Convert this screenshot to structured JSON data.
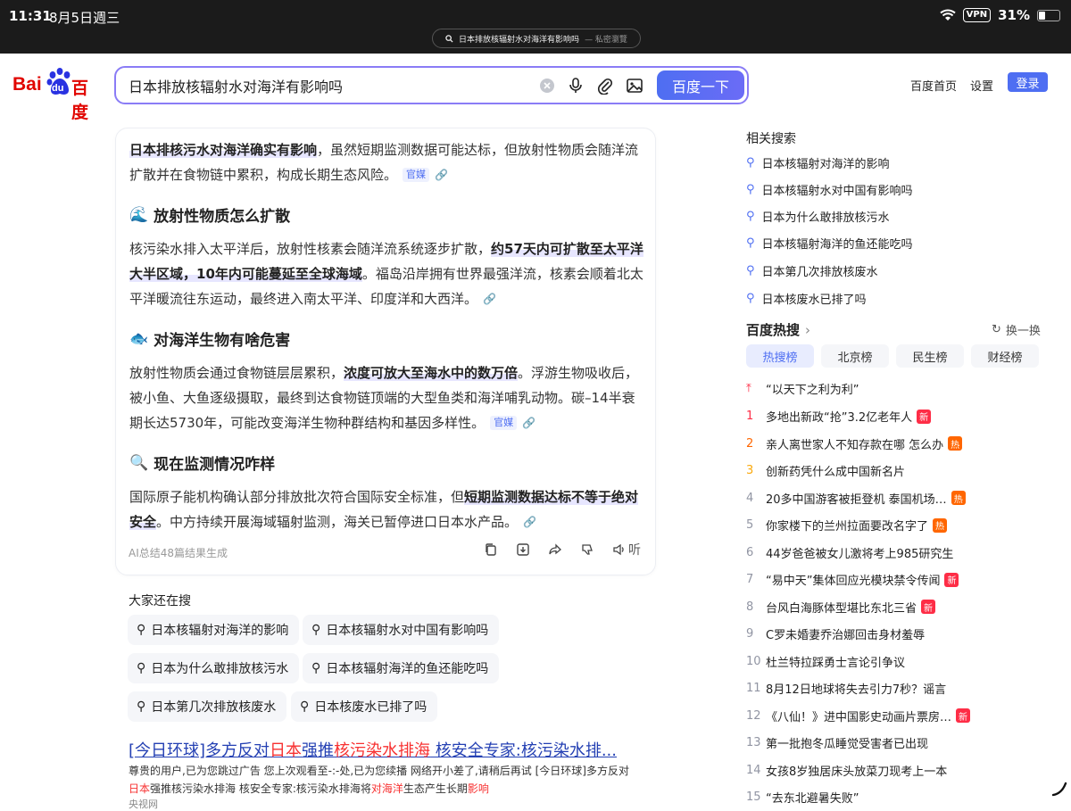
{
  "status_bar": {
    "time": "11:31",
    "date": "8月5日週三",
    "vpn": "VPN",
    "battery": "31%",
    "battery_level": 0.31
  },
  "url_bar": {
    "query": "日本排放核辐射水对海洋有影响吗",
    "mode": "— 私密瀏覽"
  },
  "header": {
    "logo_text_left": "Bai",
    "logo_text_paw": "du",
    "logo_text_right": "百度",
    "search_value": "日本排放核辐射水对海洋有影响吗",
    "search_button": "百度一下",
    "links": [
      "百度首页",
      "设置"
    ],
    "login": "登录"
  },
  "ai_card": {
    "intro_hl": "日本排核污水对海洋确实有影响",
    "intro_text": "，虽然短期监测数据可能达标，但放射性物质会随洋流扩散并在食物链中累积，构成长期生态风险。",
    "intro_tag": "官媒",
    "s1_emoji": "🌊",
    "s1_title": "放射性物质怎么扩散",
    "s1_a": "核污染水排入太平洋后，放射性核素会随洋流系统逐步扩散，",
    "s1_hl": "约57天内可扩散至太平洋大半区域，10年内可能蔓延至全球海域",
    "s1_b": "。福岛沿岸拥有世界最强洋流，核素会顺着北太平洋暖流往东运动，最终进入南太平洋、印度洋和大西洋。",
    "s2_emoji": "🐟",
    "s2_title": "对海洋生物有啥危害",
    "s2_a": "放射性物质会通过食物链层层累积，",
    "s2_hl": "浓度可放大至海水中的数万倍",
    "s2_b": "。浮游生物吸收后，被小鱼、大鱼逐级摄取，最终到达食物链顶端的大型鱼类和海洋哺乳动物。碳–14半衰期长达5730年，可能改变海洋生物种群结构和基因多样性。",
    "s2_tag": "官媒",
    "s3_emoji": "🔍",
    "s3_title": "现在监测情况咋样",
    "s3_a": "国际原子能机构确认部分排放批次符合国际安全标准，但",
    "s3_hl": "短期监测数据达标不等于绝对安全",
    "s3_b": "。中方持续开展海域辐射监测，海关已暂停进口日本水产品。",
    "footer": "AI总结48篇结果生成",
    "listen": "听"
  },
  "everyone_searches": {
    "title": "大家还在搜",
    "chips": [
      "日本核辐射对海洋的影响",
      "日本核辐射水对中国有影响吗",
      "日本为什么敢排放核污水",
      "日本核辐射海洋的鱼还能吃吗",
      "日本第几次排放核废水",
      "日本核废水已排了吗"
    ]
  },
  "result": {
    "title_parts": [
      "[今日环球]多方反对",
      "日本",
      "强推",
      "核污染水",
      "排海",
      " 核安全专家:核污染水排..."
    ],
    "snippet_line1": "尊贵的用户,已为您跳过广告 您上次观看至-:-处,已为您续播 网络开小差了,请稍后再试 [今日环球]多方反对",
    "snippet_line2_parts": [
      "日本",
      "强推核污染水排海 核安全专家:核污染水排海将",
      "对海洋",
      "生态产生长期",
      "影响"
    ],
    "source": "央视网"
  },
  "related": {
    "title": "相关搜索",
    "items": [
      "日本核辐射对海洋的影响",
      "日本核辐射水对中国有影响吗",
      "日本为什么敢排放核污水",
      "日本核辐射海洋的鱼还能吃吗",
      "日本第几次排放核废水",
      "日本核废水已排了吗"
    ]
  },
  "hot": {
    "title": "百度热搜",
    "refresh": "换一换",
    "tabs": [
      "热搜榜",
      "北京榜",
      "民生榜",
      "财经榜"
    ],
    "pinned": "“以天下之利为利”",
    "rows": [
      {
        "rank": "1",
        "text": "多地出新政“抢”3.2亿老年人",
        "badge": "新"
      },
      {
        "rank": "2",
        "text": "亲人离世家人不知存款在哪 怎么办",
        "badge": "热"
      },
      {
        "rank": "3",
        "text": "创新药凭什么成中国新名片",
        "badge": ""
      },
      {
        "rank": "4",
        "text": "20多中国游客被拒登机 泰国机场…",
        "badge": "热"
      },
      {
        "rank": "5",
        "text": "你家楼下的兰州拉面要改名字了",
        "badge": "热"
      },
      {
        "rank": "6",
        "text": "44岁爸爸被女儿激将考上985研究生",
        "badge": ""
      },
      {
        "rank": "7",
        "text": "“易中天”集体回应光模块禁令传闻",
        "badge": "新"
      },
      {
        "rank": "8",
        "text": "台风白海豚体型堪比东北三省",
        "badge": "新"
      },
      {
        "rank": "9",
        "text": "C罗未婚妻乔治娜回击身材羞辱",
        "badge": ""
      },
      {
        "rank": "10",
        "text": "杜兰特拉踩勇士言论引争议",
        "badge": ""
      },
      {
        "rank": "11",
        "text": "8月12日地球将失去引力7秒？谣言",
        "badge": ""
      },
      {
        "rank": "12",
        "text": "《八仙！》进中国影史动画片票房…",
        "badge": "新"
      },
      {
        "rank": "13",
        "text": "第一批抱冬瓜睡觉受害者已出现",
        "badge": ""
      },
      {
        "rank": "14",
        "text": "女孩8岁独居床头放菜刀现考上一本",
        "badge": ""
      },
      {
        "rank": "15",
        "text": "“去东北避暑失败”",
        "badge": ""
      }
    ]
  },
  "colors": {
    "accent": "#4e6ef2",
    "hot_red": "#fe2d46",
    "hot_orange": "#ff6600"
  }
}
